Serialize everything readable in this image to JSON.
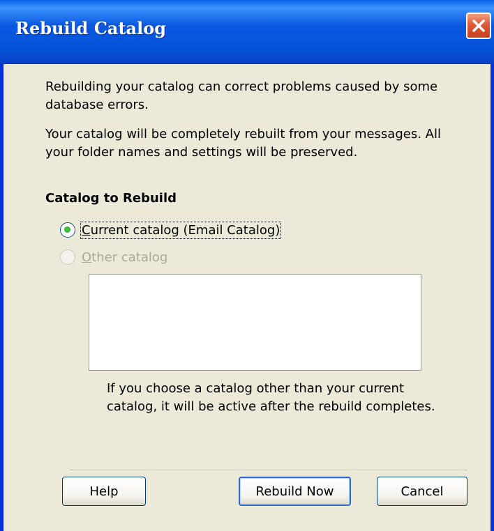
{
  "window": {
    "title": "Rebuild Catalog",
    "close_icon": "close-icon"
  },
  "content": {
    "paragraph1": "Rebuilding your catalog can correct problems caused by some database errors.",
    "paragraph2": "Your catalog will be completely rebuilt from your messages. All your folder names and settings will be preserved.",
    "section_title": "Catalog to Rebuild",
    "options": [
      {
        "mnemonic": "C",
        "rest": "urrent catalog (Email Catalog)",
        "selected": true,
        "enabled": true
      },
      {
        "mnemonic": "O",
        "rest": "ther catalog",
        "selected": false,
        "enabled": false
      }
    ],
    "catalog_list_items": [],
    "note": "If you choose a catalog other than your current catalog, it will be active after the rebuild completes."
  },
  "buttons": {
    "help": "Help",
    "rebuild": "Rebuild Now",
    "cancel": "Cancel"
  },
  "colors": {
    "titlebar": "#0553d8",
    "dialog_bg": "#ece9d8",
    "close_button": "#dc5a3a",
    "disabled_text": "#aca899"
  }
}
